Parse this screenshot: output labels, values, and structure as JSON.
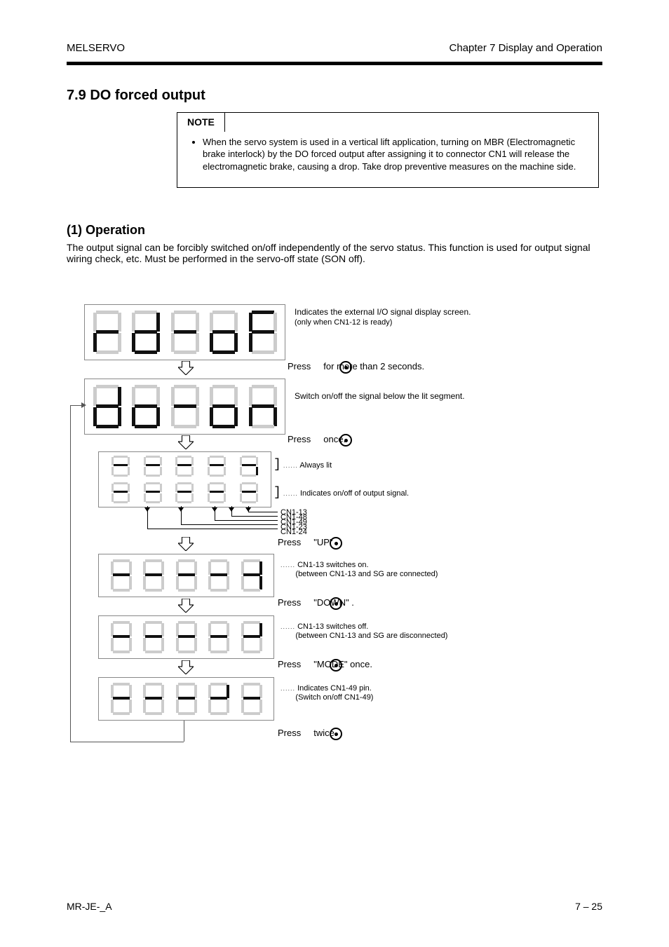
{
  "header": {
    "left": "MELSERVO",
    "right": "Chapter 7  Display and Operation"
  },
  "section_title": "7.9  DO forced output",
  "note": {
    "label": "NOTE",
    "items": [
      "When the servo system is used in a vertical lift application, turning on MBR (Electromagnetic brake interlock) by the DO forced output after assigning it to connector CN1 will release the electromagnetic brake, causing a drop. Take drop preventive measures on the machine side."
    ]
  },
  "block": {
    "title": "(1) Operation",
    "desc": "The output signal can be forcibly switched on/off independently of the servo status. This function is used for output signal wiring check, etc. Must be performed in the servo-off state (SON off)."
  },
  "displays": {
    "d1_label": "rd-oF",
    "d1_desc_line1": "Indicates the external I/O signal display screen.",
    "d1_desc_line2": "(only when CN1-12 is ready)",
    "d2_label": "do-on",
    "d2_desc": "Switch on/off the signal below the lit segment.",
    "row_top_note": "Always lit",
    "row_bottom_note": "Indicates on/off of output signal.",
    "double_callouts": {
      "c24": "CN1-24",
      "c23": "CN1-23",
      "c49": "CN1-49",
      "c48": "CN1-48",
      "c13": "CN1-13"
    },
    "d4_note_line1": "CN1-13 switches on.",
    "d4_note_line2": "(between CN1-13 and SG are connected)",
    "d5_note_line1": "CN1-13 switches off.",
    "d5_note_line2": "(between CN1-13 and SG are disconnected)",
    "d6_note_line1": "Indicates CN1-49 pin.",
    "d6_note_line2": "(Switch on/off CN1-49)",
    "press_once": "Press     once.",
    "press_twice": "Press     twice.",
    "press_hold": "Press     for more than 2 seconds.",
    "key_up": "Press     \"UP\" .",
    "key_down": "Press     \"DOWN\" .",
    "key_mode": "Press     \"MODE\" once."
  },
  "footer": {
    "left": "MR-JE-_A",
    "right": "7 – 25"
  }
}
